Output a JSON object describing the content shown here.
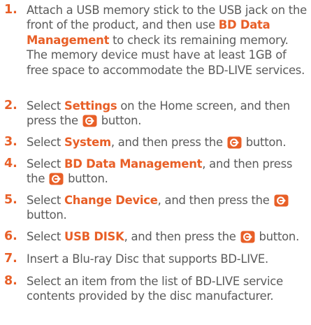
{
  "steps": [
    {
      "number": "1.",
      "segments": [
        {
          "t": "Attach a USB memory stick to the USB jack on the front of the product, and then use "
        },
        {
          "t": "BD Data Management",
          "b": true
        },
        {
          "t": " to check its remaining memory. The memory device must have at least 1GB of free space to accommodate the BD-LIVE services."
        }
      ]
    },
    {
      "number": "2.",
      "segments": [
        {
          "t": "Select "
        },
        {
          "t": "Settings",
          "b": true
        },
        {
          "t": " on the Home screen, and then press the "
        },
        {
          "icon": "enter-button-icon"
        },
        {
          "t": " button."
        }
      ]
    },
    {
      "number": "3.",
      "segments": [
        {
          "t": "Select "
        },
        {
          "t": "System",
          "b": true
        },
        {
          "t": ", and then press the "
        },
        {
          "icon": "enter-button-icon"
        },
        {
          "t": " button."
        }
      ]
    },
    {
      "number": "4.",
      "segments": [
        {
          "t": "Select "
        },
        {
          "t": "BD Data Management",
          "b": true
        },
        {
          "t": ", and then press the "
        },
        {
          "icon": "enter-button-icon"
        },
        {
          "t": " button."
        }
      ]
    },
    {
      "number": "5.",
      "segments": [
        {
          "t": "Select "
        },
        {
          "t": "Change Device",
          "b": true
        },
        {
          "t": ", and then press the "
        },
        {
          "icon": "enter-button-icon"
        },
        {
          "t": " button."
        }
      ]
    },
    {
      "number": "6.",
      "segments": [
        {
          "t": "Select "
        },
        {
          "t": "USB DISK",
          "b": true
        },
        {
          "t": ", and then press the "
        },
        {
          "icon": "enter-button-icon"
        },
        {
          "t": " button."
        }
      ]
    },
    {
      "number": "7.",
      "segments": [
        {
          "t": "Insert a Blu-ray Disc that supports BD-LIVE."
        }
      ]
    },
    {
      "number": "8.",
      "segments": [
        {
          "t": "Select an item from the list of BD-LIVE service contents provided by the disc manufacturer."
        }
      ]
    }
  ],
  "colors": {
    "accent": "#e85f27",
    "body_text": "#5b5b5b",
    "button_icon_fill": "#e85f27"
  }
}
